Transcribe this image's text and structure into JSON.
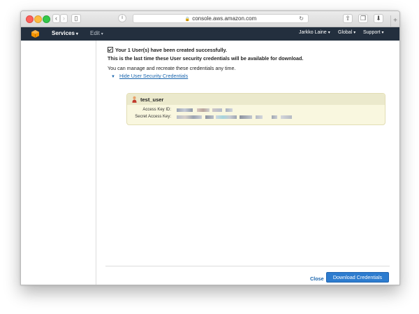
{
  "browser": {
    "url": "console.aws.amazon.com",
    "lock_icon": "lock-icon",
    "reload_icon": "reload-icon"
  },
  "nav": {
    "services_label": "Services",
    "edit_label": "Edit",
    "user_label": "Jarkko Laine",
    "region_label": "Global",
    "support_label": "Support",
    "bg_color": "#232f3e",
    "logo_color": "#f79400"
  },
  "message": {
    "success": "Your 1 User(s) have been created successfully.",
    "warning": "This is the last time these User security credentials will be available for download.",
    "info": "You can manage and recreate these credentials any time.",
    "toggle_label": "Hide User Security Credentials"
  },
  "credentials": {
    "username": "test_user",
    "access_key_label": "Access Key ID:",
    "secret_key_label": "Secret Access Key:"
  },
  "footer": {
    "close_label": "Close",
    "download_label": "Download Credentials",
    "accent_color": "#2d7ccf"
  }
}
